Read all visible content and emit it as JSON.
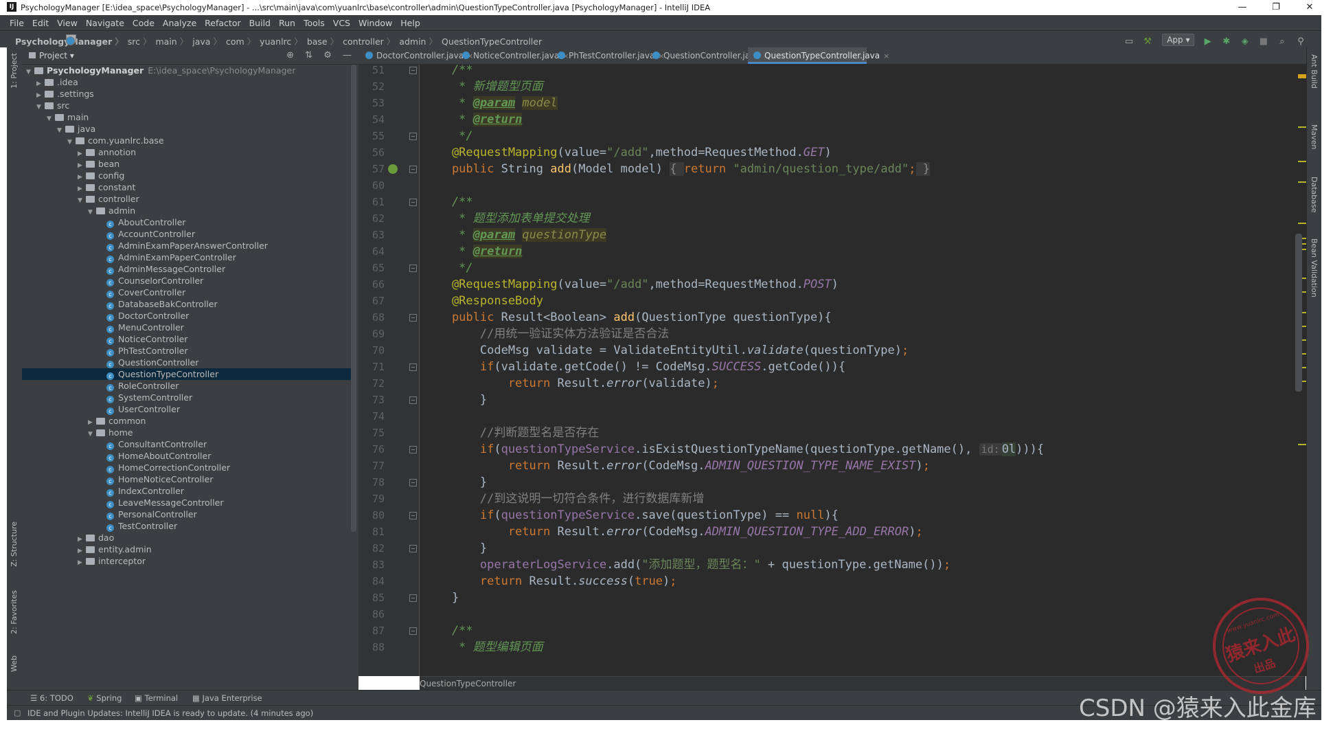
{
  "window": {
    "title": "PsychologyManager [E:\\idea_space\\PsychologyManager] - ...\\src\\main\\java\\com\\yuanlrc\\base\\controller\\admin\\QuestionTypeController.java [PsychologyManager] - IntelliJ IDEA",
    "minimize": "—",
    "restore": "❐",
    "close": "✕"
  },
  "menu": [
    "File",
    "Edit",
    "View",
    "Navigate",
    "Code",
    "Analyze",
    "Refactor",
    "Build",
    "Run",
    "Tools",
    "VCS",
    "Window",
    "Help"
  ],
  "breadcrumbs": [
    "PsychologyManager",
    "src",
    "main",
    "java",
    "com",
    "yuanlrc",
    "base",
    "controller",
    "admin",
    "QuestionTypeController"
  ],
  "run_config": "App",
  "project_panel": {
    "title": "Project",
    "tree": [
      {
        "label": "PsychologyManager",
        "path": "E:\\idea_space\\PsychologyManager",
        "depth": 0,
        "kind": "folder",
        "open": true,
        "bold": true
      },
      {
        "label": ".idea",
        "depth": 1,
        "kind": "folder",
        "open": false
      },
      {
        "label": ".settings",
        "depth": 1,
        "kind": "folder",
        "open": false
      },
      {
        "label": "src",
        "depth": 1,
        "kind": "folder",
        "open": true
      },
      {
        "label": "main",
        "depth": 2,
        "kind": "folder",
        "open": true
      },
      {
        "label": "java",
        "depth": 3,
        "kind": "folder",
        "open": true
      },
      {
        "label": "com.yuanlrc.base",
        "depth": 4,
        "kind": "folder",
        "open": true
      },
      {
        "label": "annotion",
        "depth": 5,
        "kind": "folder",
        "open": false
      },
      {
        "label": "bean",
        "depth": 5,
        "kind": "folder",
        "open": false
      },
      {
        "label": "config",
        "depth": 5,
        "kind": "folder",
        "open": false
      },
      {
        "label": "constant",
        "depth": 5,
        "kind": "folder",
        "open": false
      },
      {
        "label": "controller",
        "depth": 5,
        "kind": "folder",
        "open": true
      },
      {
        "label": "admin",
        "depth": 6,
        "kind": "folder",
        "open": true
      },
      {
        "label": "AboutController",
        "depth": 7,
        "kind": "class"
      },
      {
        "label": "AccountController",
        "depth": 7,
        "kind": "class"
      },
      {
        "label": "AdminExamPaperAnswerController",
        "depth": 7,
        "kind": "class"
      },
      {
        "label": "AdminExamPaperController",
        "depth": 7,
        "kind": "class"
      },
      {
        "label": "AdminMessageController",
        "depth": 7,
        "kind": "class"
      },
      {
        "label": "CounselorController",
        "depth": 7,
        "kind": "class"
      },
      {
        "label": "CoverController",
        "depth": 7,
        "kind": "class"
      },
      {
        "label": "DatabaseBakController",
        "depth": 7,
        "kind": "class"
      },
      {
        "label": "DoctorController",
        "depth": 7,
        "kind": "class"
      },
      {
        "label": "MenuController",
        "depth": 7,
        "kind": "class"
      },
      {
        "label": "NoticeController",
        "depth": 7,
        "kind": "class"
      },
      {
        "label": "PhTestController",
        "depth": 7,
        "kind": "class"
      },
      {
        "label": "QuestionController",
        "depth": 7,
        "kind": "class"
      },
      {
        "label": "QuestionTypeController",
        "depth": 7,
        "kind": "class",
        "selected": true
      },
      {
        "label": "RoleController",
        "depth": 7,
        "kind": "class"
      },
      {
        "label": "SystemController",
        "depth": 7,
        "kind": "class"
      },
      {
        "label": "UserController",
        "depth": 7,
        "kind": "class"
      },
      {
        "label": "common",
        "depth": 6,
        "kind": "folder",
        "open": false
      },
      {
        "label": "home",
        "depth": 6,
        "kind": "folder",
        "open": true
      },
      {
        "label": "ConsultantController",
        "depth": 7,
        "kind": "class"
      },
      {
        "label": "HomeAboutController",
        "depth": 7,
        "kind": "class"
      },
      {
        "label": "HomeCorrectionController",
        "depth": 7,
        "kind": "class"
      },
      {
        "label": "HomeNoticeController",
        "depth": 7,
        "kind": "class"
      },
      {
        "label": "IndexController",
        "depth": 7,
        "kind": "class"
      },
      {
        "label": "LeaveMessageController",
        "depth": 7,
        "kind": "class"
      },
      {
        "label": "PersonalController",
        "depth": 7,
        "kind": "class"
      },
      {
        "label": "TestController",
        "depth": 7,
        "kind": "class"
      },
      {
        "label": "dao",
        "depth": 5,
        "kind": "folder",
        "open": false
      },
      {
        "label": "entity.admin",
        "depth": 5,
        "kind": "folder",
        "open": false
      },
      {
        "label": "interceptor",
        "depth": 5,
        "kind": "folder",
        "open": false
      }
    ]
  },
  "tabs": [
    {
      "label": "DoctorController.java",
      "active": false
    },
    {
      "label": "NoticeController.java",
      "active": false
    },
    {
      "label": "PhTestController.java",
      "active": false
    },
    {
      "label": "QuestionController.java",
      "active": false
    },
    {
      "label": "QuestionTypeController.java",
      "active": true
    }
  ],
  "editor": {
    "line_numbers": [
      "51",
      "52",
      "53",
      "54",
      "55",
      "56",
      "57",
      "60",
      "61",
      "62",
      "63",
      "64",
      "65",
      "66",
      "67",
      "68",
      "69",
      "70",
      "71",
      "72",
      "73",
      "74",
      "75",
      "76",
      "77",
      "78",
      "79",
      "80",
      "81",
      "82",
      "83",
      "84",
      "85",
      "86",
      "87",
      "88"
    ],
    "lines": [
      [
        [
          "doc",
          "    /**"
        ]
      ],
      [
        [
          "doc",
          "     * 新增题型页面"
        ]
      ],
      [
        [
          "doc",
          "     * "
        ],
        [
          "doctag",
          "@param"
        ],
        [
          "doc",
          " "
        ],
        [
          "docval",
          "model"
        ]
      ],
      [
        [
          "doc",
          "     * "
        ],
        [
          "doctag",
          "@return"
        ]
      ],
      [
        [
          "doc",
          "     */"
        ]
      ],
      [
        [
          "an",
          "    @RequestMapping"
        ],
        [
          "p",
          "(value="
        ],
        [
          "str",
          "\"/add\""
        ],
        [
          "p",
          ",method=RequestMethod."
        ],
        [
          "sfld",
          "GET"
        ],
        [
          "p",
          ")"
        ]
      ],
      [
        [
          "kw",
          "    public "
        ],
        [
          "p",
          "String "
        ],
        [
          "fn",
          "add"
        ],
        [
          "p",
          "(Model model) "
        ],
        [
          "fi",
          "{ "
        ],
        [
          "kw",
          "return "
        ],
        [
          "str",
          "\"admin/question_type/add\""
        ],
        [
          "kw",
          ";"
        ],
        [
          "fi",
          " }"
        ]
      ],
      [
        [
          "p",
          ""
        ]
      ],
      [
        [
          "doc",
          "    /**"
        ]
      ],
      [
        [
          "doc",
          "     * 题型添加表单提交处理"
        ]
      ],
      [
        [
          "doc",
          "     * "
        ],
        [
          "doctag",
          "@param"
        ],
        [
          "doc",
          " "
        ],
        [
          "docval",
          "questionType"
        ]
      ],
      [
        [
          "doc",
          "     * "
        ],
        [
          "doctag",
          "@return"
        ]
      ],
      [
        [
          "doc",
          "     */"
        ]
      ],
      [
        [
          "an",
          "    @RequestMapping"
        ],
        [
          "p",
          "(value="
        ],
        [
          "str",
          "\"/add\""
        ],
        [
          "p",
          ",method=RequestMethod."
        ],
        [
          "sfld",
          "POST"
        ],
        [
          "p",
          ")"
        ]
      ],
      [
        [
          "an",
          "    @ResponseBody"
        ]
      ],
      [
        [
          "kw",
          "    public "
        ],
        [
          "p",
          "Result<Boolean> "
        ],
        [
          "fn",
          "add"
        ],
        [
          "p",
          "(QuestionType questionType){"
        ]
      ],
      [
        [
          "com",
          "        //用统一验证实体方法验证是否合法"
        ]
      ],
      [
        [
          "p",
          "        CodeMsg validate = ValidateEntityUtil."
        ],
        [
          "sm",
          "validate"
        ],
        [
          "p",
          "(questionType)"
        ],
        [
          "kw",
          ";"
        ]
      ],
      [
        [
          "kw",
          "        if"
        ],
        [
          "p",
          "(validate.getCode() != CodeMsg."
        ],
        [
          "sfld",
          "SUCCESS"
        ],
        [
          "p",
          ".getCode()){"
        ]
      ],
      [
        [
          "kw",
          "            return "
        ],
        [
          "p",
          "Result."
        ],
        [
          "sm",
          "error"
        ],
        [
          "p",
          "(validate)"
        ],
        [
          "kw",
          ";"
        ]
      ],
      [
        [
          "p",
          "        }"
        ]
      ],
      [
        [
          "p",
          ""
        ]
      ],
      [
        [
          "com",
          "        //判断题型名是否存在"
        ]
      ],
      [
        [
          "kw",
          "        if"
        ],
        [
          "p",
          "("
        ],
        [
          "fld",
          "questionTypeService"
        ],
        [
          "p",
          ".isExistQuestionTypeName(questionType.getName(), "
        ],
        [
          "hint",
          "id:"
        ],
        [
          "hlp",
          "0l"
        ],
        [
          "p",
          "))){"
        ]
      ],
      [
        [
          "kw",
          "            return "
        ],
        [
          "p",
          "Result."
        ],
        [
          "sm",
          "error"
        ],
        [
          "p",
          "(CodeMsg."
        ],
        [
          "sfld",
          "ADMIN_QUESTION_TYPE_NAME_EXIST"
        ],
        [
          "p",
          ")"
        ],
        [
          "kw",
          ";"
        ]
      ],
      [
        [
          "p",
          "        }"
        ]
      ],
      [
        [
          "com",
          "        //到这说明一切符合条件，进行数据库新增"
        ]
      ],
      [
        [
          "kw",
          "        if"
        ],
        [
          "p",
          "("
        ],
        [
          "fld",
          "questionTypeService"
        ],
        [
          "p",
          ".save(questionType) == "
        ],
        [
          "kw",
          "null"
        ],
        [
          "p",
          "){"
        ]
      ],
      [
        [
          "kw",
          "            return "
        ],
        [
          "p",
          "Result."
        ],
        [
          "sm",
          "error"
        ],
        [
          "p",
          "(CodeMsg."
        ],
        [
          "sfld",
          "ADMIN_QUESTION_TYPE_ADD_ERROR"
        ],
        [
          "p",
          ")"
        ],
        [
          "kw",
          ";"
        ]
      ],
      [
        [
          "p",
          "        }"
        ]
      ],
      [
        [
          "fld",
          "        operaterLogService"
        ],
        [
          "p",
          ".add("
        ],
        [
          "str",
          "\"添加题型，题型名：\""
        ],
        [
          "p",
          " + questionType.getName())"
        ],
        [
          "kw",
          ";"
        ]
      ],
      [
        [
          "kw",
          "        return "
        ],
        [
          "p",
          "Result."
        ],
        [
          "sm",
          "success"
        ],
        [
          "p",
          "("
        ],
        [
          "kw",
          "true"
        ],
        [
          "p",
          ")"
        ],
        [
          "kw",
          ";"
        ]
      ],
      [
        [
          "p",
          "    }"
        ]
      ],
      [
        [
          "p",
          ""
        ]
      ],
      [
        [
          "doc",
          "    /**"
        ]
      ],
      [
        [
          "doc",
          "     * 题型编辑页面"
        ]
      ]
    ],
    "footer_breadcrumb": "QuestionTypeController"
  },
  "left_stripe": {
    "project": "1: Project",
    "structure": "Z: Structure",
    "favorites": "2: Favorites",
    "web": "Web"
  },
  "right_stripe": {
    "ant": "Ant Build",
    "maven": "Maven",
    "database": "Database",
    "bean": "Bean Validation"
  },
  "bottom_tools": [
    "6: TODO",
    "Spring",
    "Terminal",
    "Java Enterprise"
  ],
  "status_message": "IDE and Plugin Updates: IntelliJ IDEA is ready to update. (4 minutes ago)",
  "watermark": "CSDN @猿来入此金库",
  "seal": {
    "text": "猿来入此",
    "sub": "出品",
    "url": "www.yuanlrc.com"
  }
}
